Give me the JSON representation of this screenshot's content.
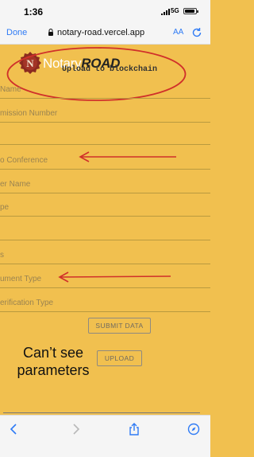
{
  "status_bar": {
    "time": "1:36",
    "network": "5G"
  },
  "browser": {
    "done_label": "Done",
    "url": "notary-road.vercel.app",
    "text_size_label": "AA"
  },
  "logo": {
    "text_light": "Notary",
    "text_bold": "ROAD"
  },
  "annotation": {
    "upload_note": "Upload to blockchain",
    "missing_note": "Can’t see parameters"
  },
  "form": {
    "fields": [
      {
        "label": "Name"
      },
      {
        "label": "mission Number"
      },
      {
        "label": ""
      },
      {
        "label": "o Conference"
      },
      {
        "label": "er Name"
      },
      {
        "label": "pe"
      },
      {
        "label": ""
      },
      {
        "label": "s"
      },
      {
        "label": "ument Type"
      },
      {
        "label": "erification Type"
      }
    ],
    "submit_label": "SUBMIT DATA",
    "upload_label": "UPLOAD"
  },
  "colors": {
    "page_background": "#f1c04f",
    "annotation_red": "#d0302a",
    "link_blue": "#2f7bf5"
  }
}
